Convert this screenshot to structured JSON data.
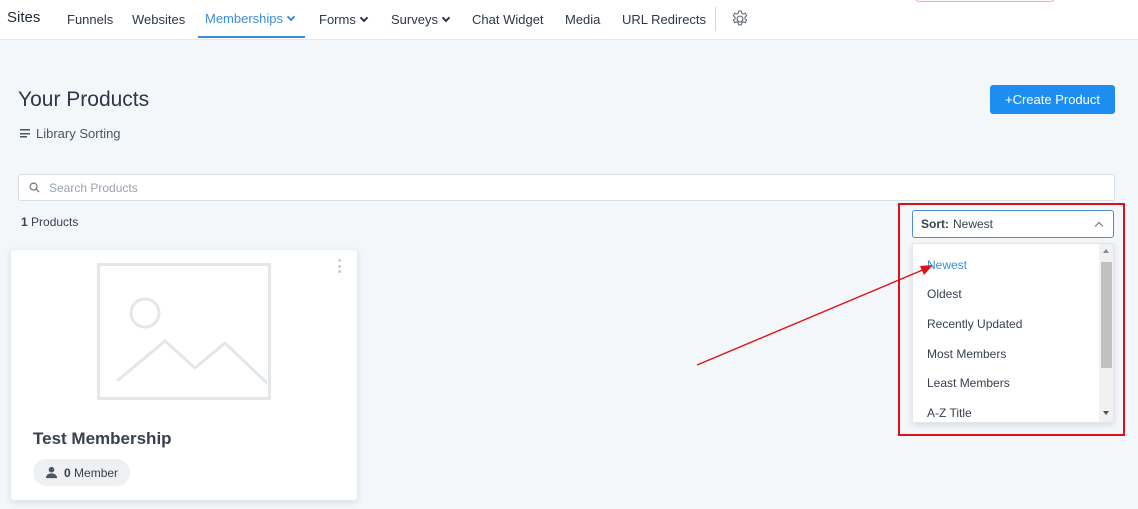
{
  "nav": {
    "brand": "Sites",
    "items": [
      {
        "label": "Funnels"
      },
      {
        "label": "Websites"
      },
      {
        "label": "Memberships"
      },
      {
        "label": "Forms"
      },
      {
        "label": "Surveys"
      },
      {
        "label": "Chat Widget"
      },
      {
        "label": "Media"
      },
      {
        "label": "URL Redirects"
      }
    ],
    "active": "Memberships",
    "accent": "#3b8ed9"
  },
  "header": {
    "title": "Your Products",
    "library_sorting": "Library Sorting",
    "create_button": "+Create Product",
    "create_button_color": "#1d8ef1"
  },
  "search": {
    "placeholder": "Search Products",
    "value": ""
  },
  "products_count": {
    "number": "1",
    "label": "Products"
  },
  "card": {
    "title": "Test Membership",
    "members_count": "0",
    "members_label": "Member"
  },
  "sort": {
    "label": "Sort:",
    "value": "Newest",
    "options": [
      "Newest",
      "Oldest",
      "Recently Updated",
      "Most Members",
      "Least Members",
      "A-Z Title"
    ],
    "selected": "Newest"
  },
  "annotation": {
    "highlight_color": "#e0101a"
  }
}
